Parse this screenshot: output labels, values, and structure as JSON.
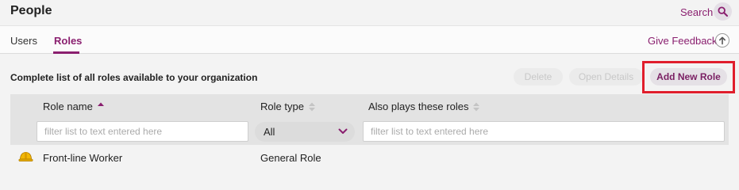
{
  "header": {
    "title": "People",
    "search_label": "Search",
    "search_icon": "search-icon"
  },
  "tabs": [
    {
      "label": "Users",
      "active": false
    },
    {
      "label": "Roles",
      "active": true
    }
  ],
  "feedback": {
    "label": "Give Feedback",
    "icon": "upload-icon"
  },
  "main": {
    "subtitle": "Complete list of all roles available to your organization",
    "actions": {
      "delete_label": "Delete",
      "open_details_label": "Open Details",
      "add_label": "Add New Role"
    }
  },
  "table": {
    "columns": [
      "Role name",
      "Role type",
      "Also plays these roles"
    ],
    "filters": {
      "name_placeholder": "filter list to text entered here",
      "type_selected": "All",
      "also_placeholder": "filter list to text entered here"
    },
    "rows": [
      {
        "icon": "hard-hat-icon",
        "name": "Front-line Worker",
        "type": "General Role",
        "also": ""
      }
    ]
  },
  "colors": {
    "accent": "#8a1f6f",
    "highlight": "#e01e2c"
  }
}
